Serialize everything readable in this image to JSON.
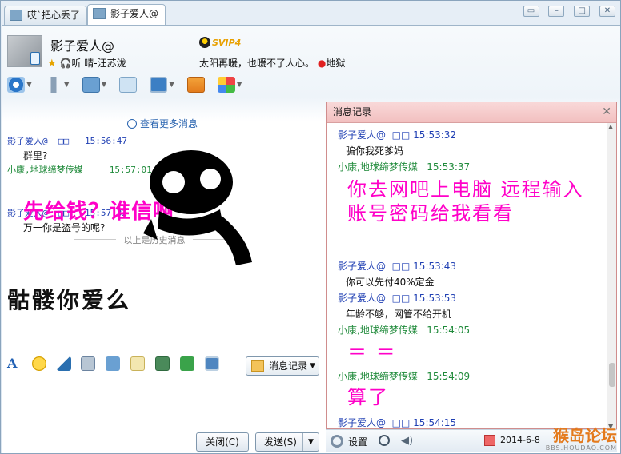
{
  "tabs": [
    {
      "label": "哎`把心丢了"
    },
    {
      "label": "影子爱人@"
    }
  ],
  "contact": {
    "name": "影子爱人@",
    "badge": "SVIP4",
    "listening_prefix": "听 ",
    "listening": "晴-汪苏泷",
    "signature": "太阳再暖，也暖不了人心。",
    "location": "地狱"
  },
  "chat": {
    "more_link": "查看更多消息",
    "messages": [
      {
        "sender": "影子爱人@",
        "marks": "□□",
        "time": "15:56:47",
        "text": "群里?"
      },
      {
        "sender": "小康,地球缔梦传媒",
        "time": "15:57:01",
        "text": ""
      },
      {
        "sender": "影子爱人@",
        "marks": "□□",
        "time": "15:57:32",
        "text": "万一你是盗号的呢?"
      }
    ],
    "history_divider": "以上是历史消息",
    "overlay_text": "先给钱？谁信啊",
    "handwritten": "骷髅你爱么"
  },
  "input": {
    "history_button": "消息记录",
    "close_button": "关闭(C)",
    "send_button": "发送(S)"
  },
  "history_panel": {
    "title": "消息记录",
    "entries": [
      {
        "sender": "影子爱人@",
        "marks": "□□",
        "time": "15:53:32",
        "text": "骗你我死爹妈"
      },
      {
        "sender": "小康,地球缔梦传媒",
        "time": "15:53:37",
        "big": "你去网吧上电脑   远程输入账号密码给我看看"
      },
      {
        "sender": "影子爱人@",
        "marks": "□□",
        "time": "15:53:43",
        "text": "你可以先付40%定金"
      },
      {
        "sender": "影子爱人@",
        "marks": "□□",
        "time": "15:53:53",
        "text": "年龄不够，网管不给开机"
      },
      {
        "sender": "小康,地球缔梦传媒",
        "time": "15:54:05",
        "big": "＝ ＝"
      },
      {
        "sender": "小康,地球缔梦传媒",
        "time": "15:54:09",
        "big": "算了"
      },
      {
        "sender": "影子爱人@",
        "marks": "□□",
        "time": "15:54:15",
        "text": ""
      }
    ],
    "settings_label": "设置",
    "date": "2014-6-8"
  },
  "watermark": {
    "line1": "猴岛论坛",
    "line2": "BBS.HOUDAO.COM"
  },
  "colors": {
    "pink_overlay": "#ff00c8",
    "blue_sender": "#1f3fb3",
    "green_sender": "#1f8a3a",
    "panel_title_bg": "#f2c0c0"
  }
}
